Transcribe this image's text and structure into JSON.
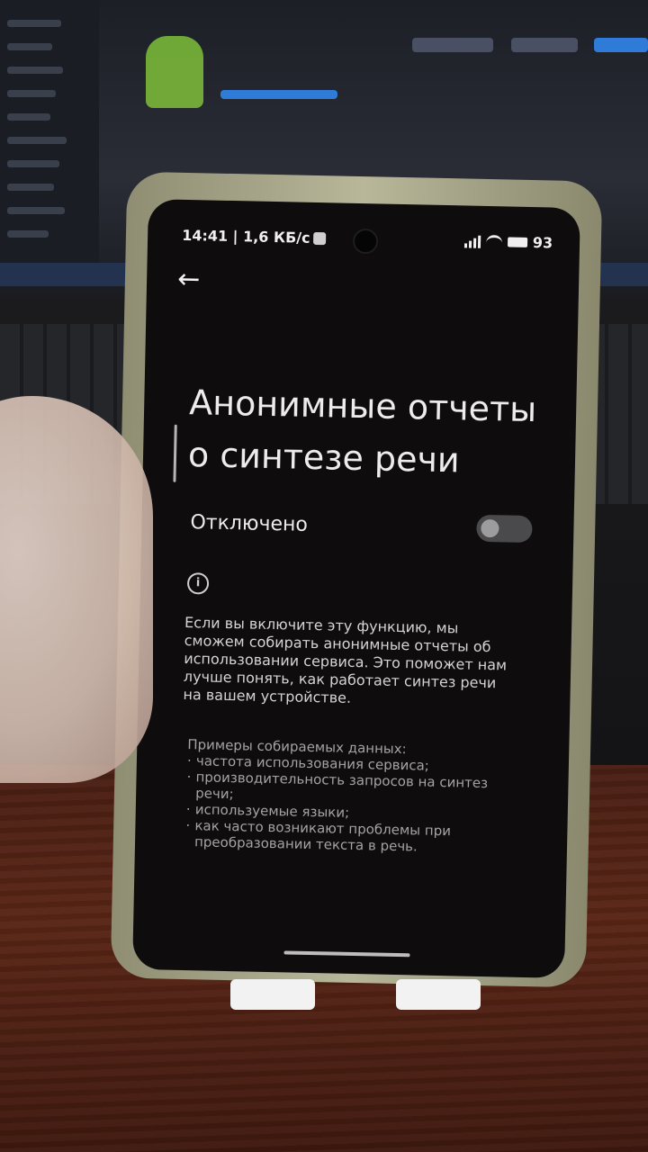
{
  "status_bar": {
    "time_and_speed": "14:41 | 1,6 КБ/с",
    "battery": "93"
  },
  "nav": {
    "back_icon": "arrow-left-icon"
  },
  "page": {
    "title": "Анонимные отчеты о синтезе речи",
    "toggle_label": "Отключено",
    "toggle_state": false,
    "info_icon": "info-circle-icon",
    "description": "Если вы включите эту функцию, мы сможем собирать анонимные отчеты об использовании сервиса. Это поможет нам лучше понять, как работает синтез речи на вашем устройстве.",
    "examples_heading": "Примеры собираемых данных:",
    "examples": [
      "частота использования сервиса;",
      "производительность запросов на синтез речи;",
      "используемые языки;",
      "как часто возникают проблемы при преобразовании текста в речь."
    ]
  },
  "colors": {
    "screen_background": "#0e0c0d",
    "text_primary": "#ececec",
    "text_secondary": "#a4a4a4",
    "toggle_off_track": "#4a4a4c"
  }
}
